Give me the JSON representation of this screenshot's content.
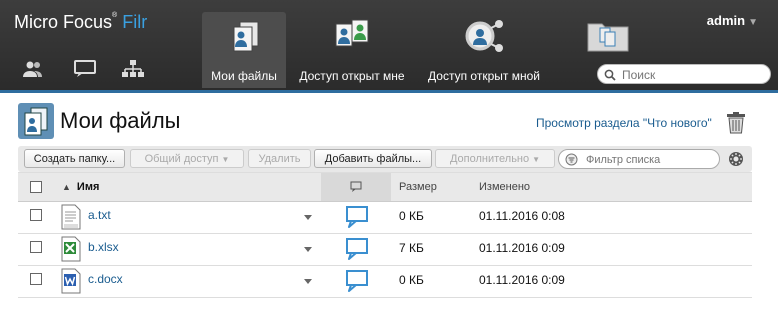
{
  "header": {
    "brand_main": "Micro Focus",
    "brand_trademark": "®",
    "brand_product": "Filr",
    "user": "admin",
    "search_placeholder": "Поиск",
    "tabs": [
      {
        "label": "Мои файлы",
        "active": true,
        "icon": "my-files-icon"
      },
      {
        "label": "Доступ открыт мне",
        "active": false,
        "icon": "shared-with-me-icon"
      },
      {
        "label": "Доступ открыт мной",
        "active": false,
        "icon": "shared-by-me-icon"
      },
      {
        "label": "",
        "active": false,
        "icon": "net-folders-icon"
      }
    ],
    "left_icons": [
      "people-icon",
      "comments-icon",
      "org-chart-icon"
    ]
  },
  "page": {
    "title": "Мои файлы",
    "whats_new_link": "Просмотр раздела \"Что нового\"",
    "trash_icon": "trash-icon"
  },
  "toolbar": {
    "new_folder": "Создать папку...",
    "share": "Общий доступ",
    "delete": "Удалить",
    "add_files": "Добавить файлы...",
    "more": "Дополнительно",
    "filter_placeholder": "Фильтр списка"
  },
  "table": {
    "columns": {
      "name": "Имя",
      "size": "Размер",
      "modified": "Изменено"
    },
    "rows": [
      {
        "name": "a.txt",
        "size": "0 КБ",
        "modified": "01.11.2016 0:08",
        "icon": "txt-file-icon"
      },
      {
        "name": "b.xlsx",
        "size": "7 КБ",
        "modified": "01.11.2016 0:09",
        "icon": "xlsx-file-icon"
      },
      {
        "name": "c.docx",
        "size": "0 КБ",
        "modified": "01.11.2016 0:09",
        "icon": "docx-file-icon"
      }
    ]
  },
  "colors": {
    "accent": "#2f6d9f",
    "link": "#1a5c8f",
    "brand_product": "#3aa0e0",
    "header_bg": "#333333"
  }
}
